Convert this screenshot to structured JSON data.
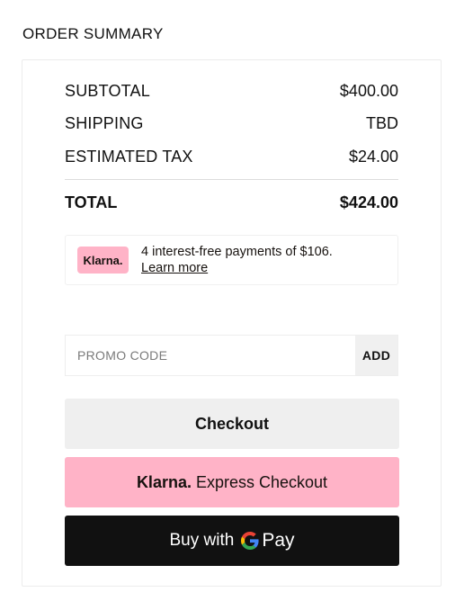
{
  "header": {
    "title": "ORDER SUMMARY"
  },
  "summary": {
    "subtotal_label": "SUBTOTAL",
    "subtotal_value": "$400.00",
    "shipping_label": "SHIPPING",
    "shipping_value": "TBD",
    "tax_label": "ESTIMATED TAX",
    "tax_value": "$24.00",
    "total_label": "TOTAL",
    "total_value": "$424.00"
  },
  "klarna": {
    "badge": "Klarna.",
    "message": "4 interest-free payments of $106.",
    "link": "Learn more",
    "color": "#ffb3c7"
  },
  "promo": {
    "placeholder": "PROMO CODE",
    "value": "",
    "button": "ADD"
  },
  "buttons": {
    "checkout": "Checkout",
    "klarna_logo": "Klarna.",
    "klarna_express": "Express Checkout",
    "gpay_prefix": "Buy with",
    "gpay_brand": "Pay",
    "gpay_icon": "google-g-icon"
  }
}
